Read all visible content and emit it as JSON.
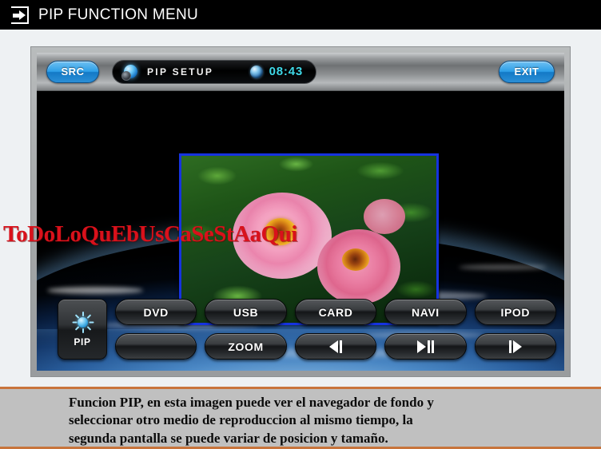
{
  "titlebar": {
    "icon": "enter-arrow-icon",
    "title": "PIP FUNCTION MENU"
  },
  "device": {
    "control_strip": {
      "src_button": "SRC",
      "status_icon": "pip-orb-icon",
      "status_label": "PIP SETUP",
      "clock_icon": "globe-icon",
      "clock": "08:43",
      "exit_button": "EXIT"
    },
    "screen": {
      "background": "earth-from-space",
      "pip_window": {
        "name": "pip-preview-window",
        "content": "pink-peony-flowers",
        "border_color": "#1633e0"
      },
      "watermark": "ToDoLoQuEbUsCaSeStAaQui"
    },
    "pad": {
      "pip_key": {
        "icon": "brightness-sun-icon",
        "label": "PIP"
      },
      "buttons_row1": [
        {
          "name": "dvd-button",
          "label": "DVD",
          "glyph": ""
        },
        {
          "name": "usb-button",
          "label": "USB",
          "glyph": ""
        },
        {
          "name": "card-button",
          "label": "CARD",
          "glyph": ""
        },
        {
          "name": "navi-button",
          "label": "NAVI",
          "glyph": ""
        },
        {
          "name": "ipod-button",
          "label": "IPOD",
          "glyph": ""
        }
      ],
      "buttons_row2": [
        {
          "name": "blank-button",
          "label": "",
          "glyph": "none"
        },
        {
          "name": "zoom-button",
          "label": "ZOOM",
          "glyph": "none"
        },
        {
          "name": "previous-button",
          "label": "",
          "glyph": "previous"
        },
        {
          "name": "play-pause-button",
          "label": "",
          "glyph": "play-pause"
        },
        {
          "name": "next-button",
          "label": "",
          "glyph": "next"
        }
      ]
    }
  },
  "caption": {
    "line1": "Funcion PIP, en esta imagen puede ver el navegador de fondo y",
    "line2": "seleccionar otro medio de reproduccion al mismo tiempo, la",
    "line3": "segunda pantalla se puede variar de posicion y tamaño."
  },
  "colors": {
    "accent_blue": "#2d9fe8",
    "clock_cyan": "#3fd9e8",
    "pip_border": "#1633e0",
    "caption_rule": "#c8743c",
    "watermark_red": "#d9111b"
  }
}
